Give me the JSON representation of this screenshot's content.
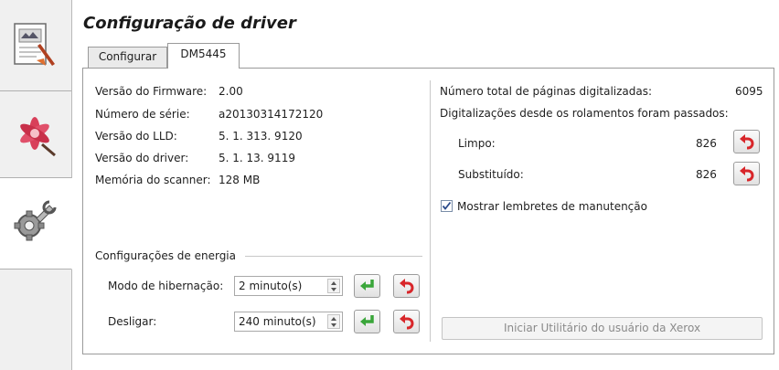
{
  "title": "Configuração de driver",
  "side_tabs": [
    {
      "icon": "document-icon"
    },
    {
      "icon": "flower-icon"
    },
    {
      "icon": "tools-icon"
    }
  ],
  "tabs": [
    "Configurar",
    "DM5445"
  ],
  "active_tab": "DM5445",
  "info": [
    {
      "label": "Versão do Firmware:",
      "value": "2.00"
    },
    {
      "label": "Número de série:",
      "value": "a20130314172120"
    },
    {
      "label": "Versão do LLD:",
      "value": "5. 1. 313. 9120"
    },
    {
      "label": "Versão do driver:",
      "value": "5. 1. 13. 9119"
    },
    {
      "label": "Memória do scanner:",
      "value": "128 MB"
    }
  ],
  "energy": {
    "group_label": "Configurações de energia",
    "sleep_label": "Modo de hibernação:",
    "sleep_value": "2 minuto(s)",
    "off_label": "Desligar:",
    "off_value": "240 minuto(s)"
  },
  "stats": {
    "total_label": "Número total de páginas digitalizadas:",
    "total_value": "6095",
    "since_label": "Digitalizações desde os rolamentos foram passados:",
    "clean_label": "Limpo:",
    "clean_value": "826",
    "replaced_label": "Substituído:",
    "replaced_value": "826"
  },
  "reminder": {
    "label": "Mostrar lembretes de manutenção",
    "checked": true
  },
  "utility_button": "Iniciar Utilitário do usuário da Xerox",
  "colors": {
    "accept": "#3aa63a",
    "reset": "#d8262a",
    "disabled_text": "#8a8a8a"
  }
}
